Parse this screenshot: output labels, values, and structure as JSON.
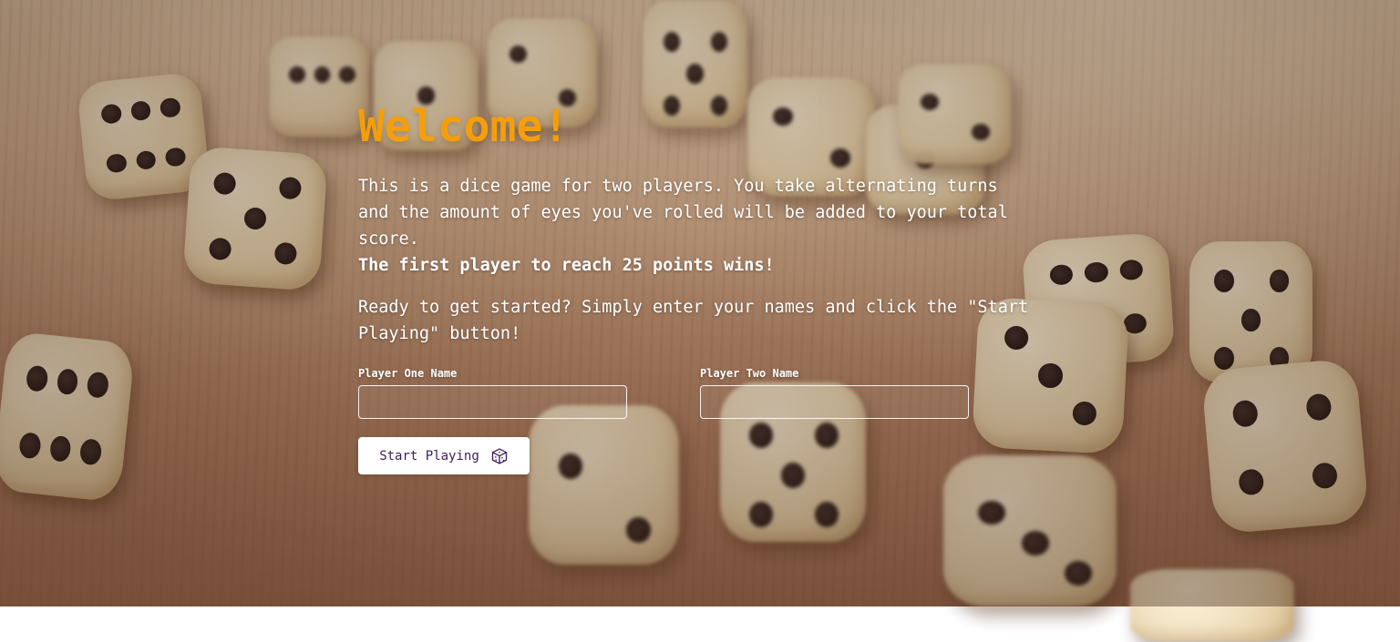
{
  "welcome": {
    "title": "Welcome!",
    "intro": "This is a dice game for two players. You take alternating turns and the amount of eyes you've rolled will be added to your total score.",
    "intro_bold": "The first player to reach 25 points wins!",
    "ready_text": "Ready to get started? Simply enter your names and click the \"Start Playing\" button!"
  },
  "form": {
    "player_one_label": "Player One Name",
    "player_one_value": "",
    "player_two_label": "Player Two Name",
    "player_two_value": "",
    "start_button_label": "Start Playing",
    "start_button_icon": "dice-icon"
  },
  "colors": {
    "title": "#f59e0b",
    "button_text": "#3b1d5e",
    "button_bg": "#ffffff"
  },
  "background": {
    "description_icon": "dice-background-image"
  }
}
